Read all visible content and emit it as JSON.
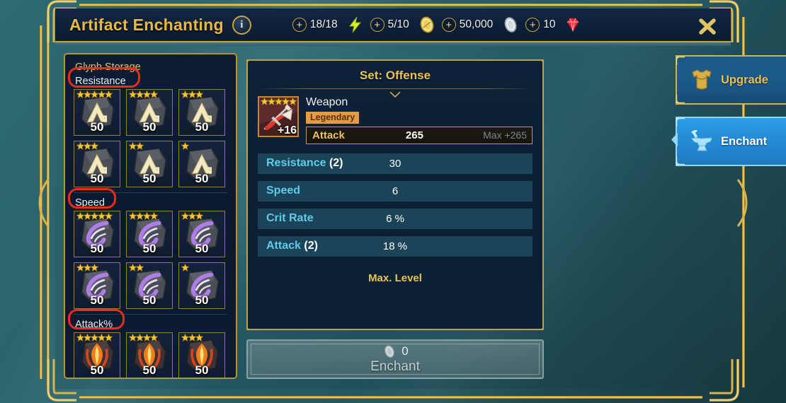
{
  "window": {
    "title": "Artifact Enchanting",
    "info_icon": "info-icon",
    "info_label": "i",
    "close_icon": "close-icon"
  },
  "currencies": [
    {
      "id": "energy",
      "plus": "+",
      "value": "18/18",
      "icon": "lightning-bolt-icon"
    },
    {
      "id": "arena",
      "plus": "+",
      "value": "5/10",
      "icon": "gold-coin-icon"
    },
    {
      "id": "silver",
      "plus": "+",
      "value": "50,000",
      "icon": "silver-coin-icon"
    },
    {
      "id": "gems",
      "plus": "+",
      "value": "10",
      "icon": "red-gem-icon"
    }
  ],
  "glyph_storage": {
    "title": "Glyph Storage",
    "categories": [
      {
        "name": "Resistance",
        "highlighted": true,
        "glyph_type": "resistance-rune",
        "rows": [
          [
            {
              "stars": 5,
              "count": "50"
            },
            {
              "stars": 4,
              "count": "50"
            },
            {
              "stars": 3,
              "count": "50"
            }
          ],
          [
            {
              "stars": 3,
              "count": "50"
            },
            {
              "stars": 2,
              "count": "50"
            },
            {
              "stars": 1,
              "count": "50"
            }
          ]
        ]
      },
      {
        "name": "Speed",
        "highlighted": true,
        "glyph_type": "speed-rune",
        "rows": [
          [
            {
              "stars": 5,
              "count": "50"
            },
            {
              "stars": 4,
              "count": "50"
            },
            {
              "stars": 3,
              "count": "50"
            }
          ],
          [
            {
              "stars": 3,
              "count": "50"
            },
            {
              "stars": 2,
              "count": "50"
            },
            {
              "stars": 1,
              "count": "50"
            }
          ]
        ]
      },
      {
        "name": "Attack%",
        "highlighted": true,
        "glyph_type": "attack-rune",
        "rows": [
          [
            {
              "stars": 5,
              "count": "50"
            },
            {
              "stars": 4,
              "count": "50"
            },
            {
              "stars": 3,
              "count": "50"
            }
          ]
        ]
      }
    ]
  },
  "item": {
    "set_title": "Set: Offense",
    "thumb_stars": 5,
    "enhance_level": "+16",
    "name": "Weapon",
    "rarity": "Legendary",
    "main_stat": {
      "label": "Attack",
      "value": "265",
      "max": "Max +265"
    },
    "substats": [
      {
        "label": "Resistance",
        "count": "(2)",
        "value": "30"
      },
      {
        "label": "Speed",
        "count": "",
        "value": "6"
      },
      {
        "label": "Crit Rate",
        "count": "",
        "value": "6 %"
      },
      {
        "label": "Attack",
        "count": "(2)",
        "value": "18 %"
      }
    ],
    "status": "Max. Level"
  },
  "enchant_button": {
    "cost_icon": "silver-coin-icon",
    "cost": "0",
    "label": "Enchant",
    "enabled": false
  },
  "tabs": [
    {
      "id": "upgrade",
      "label": "Upgrade",
      "icon": "armor-icon",
      "active": false
    },
    {
      "id": "enchant",
      "label": "Enchant",
      "icon": "anvil-icon",
      "active": true
    }
  ],
  "colors": {
    "gold": "#e9b844",
    "frame_gold": "#c9a43c",
    "panel_dark": "#0c1d33",
    "substat_bg": "#1c4459",
    "substat_label": "#5ecbe8",
    "rarity_legendary": "#e59a46",
    "tab_active": "#2489d4",
    "annotation_red": "#ef2a1d",
    "background_teal": "#28606a"
  }
}
